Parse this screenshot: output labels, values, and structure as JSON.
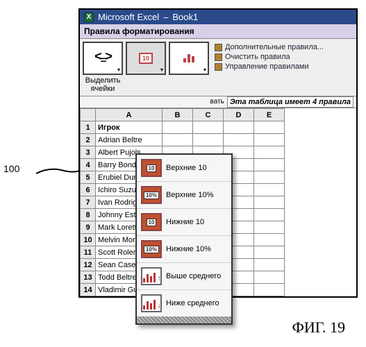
{
  "figure_callout": "100",
  "figure_label": "ФИГ. 19",
  "titlebar": {
    "app": "Microsoft Excel",
    "book": "Book1"
  },
  "ribbon": {
    "tab_title": "Правила форматирования",
    "groups": [
      {
        "label": "Выделить\nячейки"
      },
      {
        "label": ""
      },
      {
        "label": ""
      }
    ],
    "trailing_label": "вать",
    "side_links": [
      {
        "label": "Дополнительные правила..."
      },
      {
        "label": "Очистить правила"
      },
      {
        "label": "Управление правилами"
      }
    ],
    "rules_status": "Эта таблица имеет 4 правила"
  },
  "sheet": {
    "columns": [
      "A",
      "B",
      "C",
      "D",
      "E"
    ],
    "rows": [
      {
        "n": 1,
        "a": "Игрок"
      },
      {
        "n": 2,
        "a": "Adrian Beltre"
      },
      {
        "n": 3,
        "a": "Albert Pujols"
      },
      {
        "n": 4,
        "a": "Barry Bonds"
      },
      {
        "n": 5,
        "a": "Erubiel Durazo"
      },
      {
        "n": 6,
        "a": "Ichiro Suzuki"
      },
      {
        "n": 7,
        "a": "Ivan Rodriguez"
      },
      {
        "n": 8,
        "a": "Johnny Estrada"
      },
      {
        "n": 9,
        "a": "Mark Loretta"
      },
      {
        "n": 10,
        "a": "Melvin Mora"
      },
      {
        "n": 11,
        "a": "Scott Rolen"
      },
      {
        "n": 12,
        "a": "Sean Casey"
      },
      {
        "n": 13,
        "a": "Todd Beltre"
      },
      {
        "n": 14,
        "a": "Vladimir Guerrero"
      }
    ]
  },
  "dropdown": {
    "items": [
      {
        "icon": "ten-up",
        "badge": "10",
        "label": "Верхние 10"
      },
      {
        "icon": "pct-up",
        "badge": "10%",
        "label": "Верхние 10%"
      },
      {
        "icon": "ten-down",
        "badge": "10",
        "label": "Нижние 10"
      },
      {
        "icon": "pct-down",
        "badge": "10%",
        "label": "Нижние 10%"
      },
      {
        "icon": "bars-up",
        "badge": "",
        "label": "Выше среднего"
      },
      {
        "icon": "bars-down",
        "badge": "",
        "label": "Ниже среднего"
      }
    ]
  }
}
